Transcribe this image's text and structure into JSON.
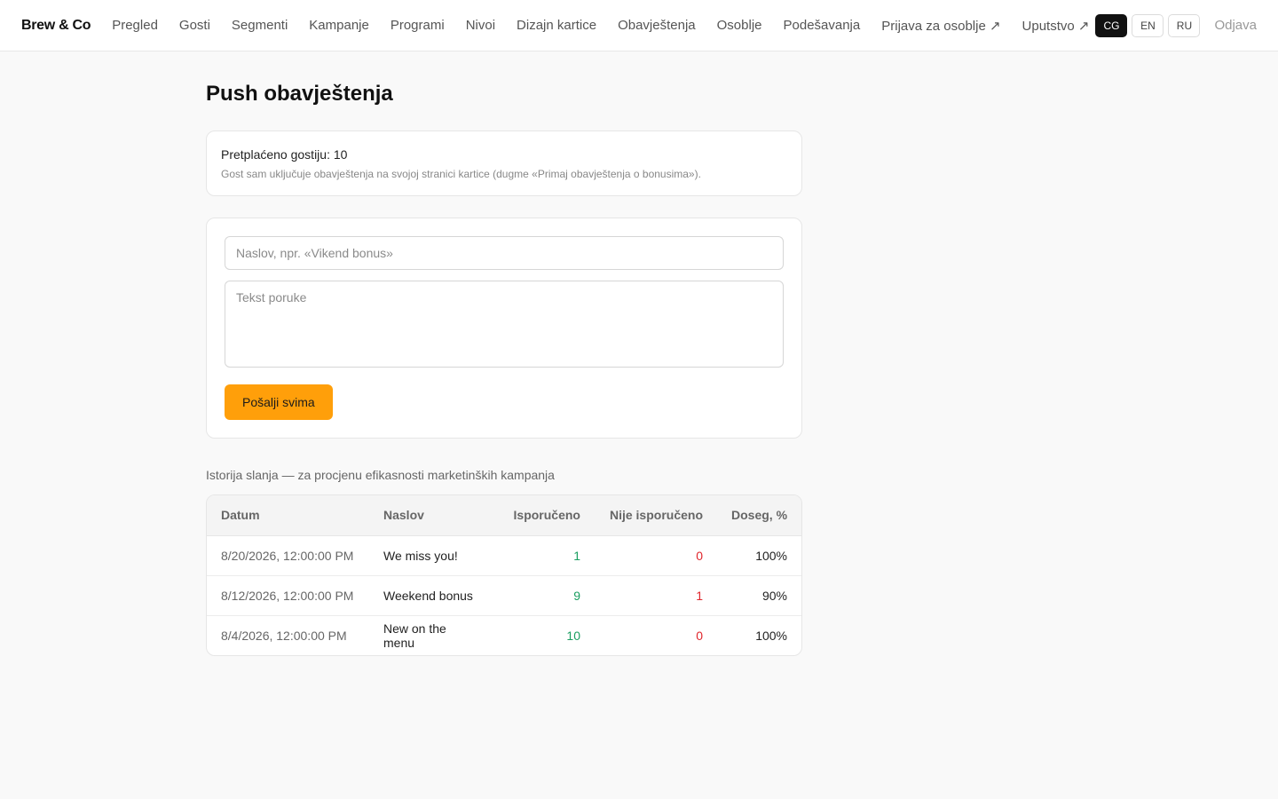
{
  "brand": "Brew & Co",
  "nav": [
    {
      "label": "Pregled",
      "name": "nav-pregled"
    },
    {
      "label": "Gosti",
      "name": "nav-gosti"
    },
    {
      "label": "Segmenti",
      "name": "nav-segmenti"
    },
    {
      "label": "Kampanje",
      "name": "nav-kampanje"
    },
    {
      "label": "Programi",
      "name": "nav-programi"
    },
    {
      "label": "Nivoi",
      "name": "nav-nivoi"
    },
    {
      "label": "Dizajn kartice",
      "name": "nav-dizajn-kartice"
    },
    {
      "label": "Obavještenja",
      "name": "nav-obavjestenja"
    },
    {
      "label": "Osoblje",
      "name": "nav-osoblje"
    },
    {
      "label": "Podešavanja",
      "name": "nav-podesavanja"
    },
    {
      "label": "Prijava za osoblje ↗",
      "name": "nav-prijava-za-osoblje"
    },
    {
      "label": "Uputstvo ↗",
      "name": "nav-uputstvo"
    }
  ],
  "languages": [
    "CG",
    "EN",
    "RU"
  ],
  "active_language": "CG",
  "logout_label": "Odjava",
  "page_title": "Push obavještenja",
  "subscribers": {
    "text": "Pretplaćeno gostiju: 10",
    "hint": "Gost sam uključuje obavještenja na svojoj stranici kartice (dugme «Primaj obavještenja o bonusima»)."
  },
  "form": {
    "title_placeholder": "Naslov, npr. «Vikend bonus»",
    "title_value": "",
    "body_placeholder": "Tekst poruke",
    "body_value": "",
    "send_label": "Pošalji svima"
  },
  "history": {
    "title": "Istorija slanja — za procjenu efikasnosti marketinških kampanja",
    "columns": [
      "Datum",
      "Naslov",
      "Isporučeno",
      "Nije isporučeno",
      "Doseg, %"
    ],
    "rows": [
      {
        "date": "8/20/2026, 12:00:00 PM",
        "title": "We miss you!",
        "delivered": "1",
        "failed": "0",
        "reach": "100%"
      },
      {
        "date": "8/12/2026, 12:00:00 PM",
        "title": "Weekend bonus",
        "delivered": "9",
        "failed": "1",
        "reach": "90%"
      },
      {
        "date": "8/4/2026, 12:00:00 PM",
        "title": "New on the menu",
        "delivered": "10",
        "failed": "0",
        "reach": "100%"
      }
    ]
  },
  "colors": {
    "accent": "#ff9f0a",
    "delivered": "#1a9e60",
    "failed": "#e0262c"
  }
}
